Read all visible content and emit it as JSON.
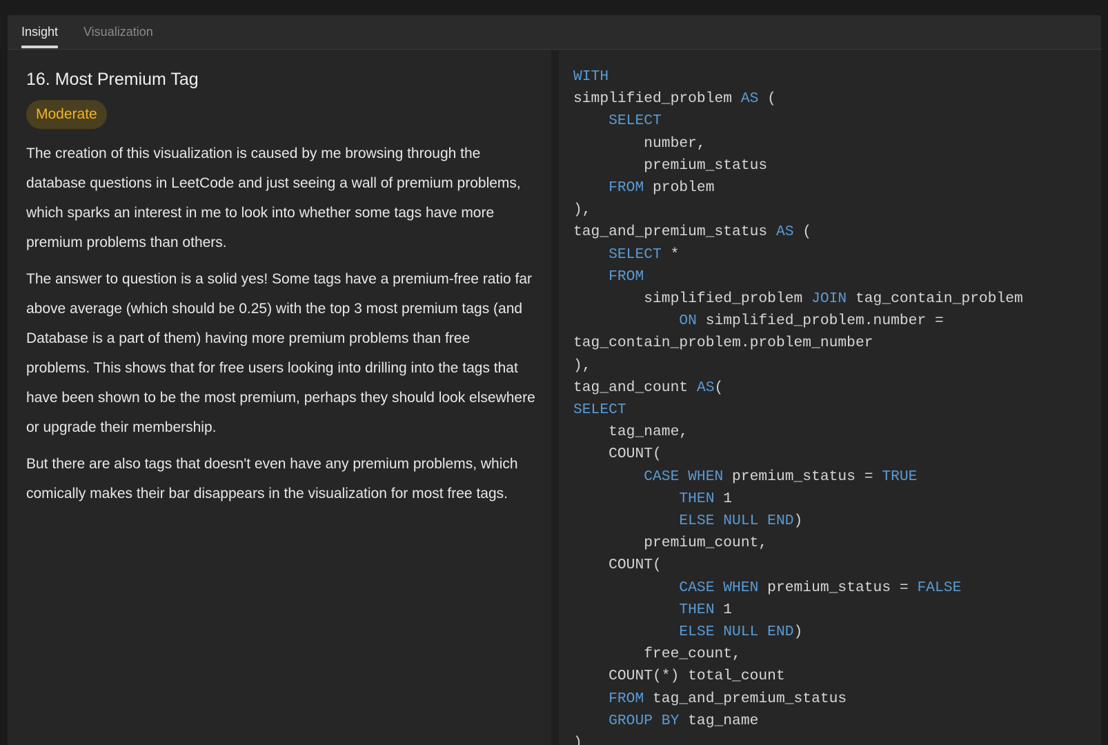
{
  "tabs": [
    {
      "label": "Insight",
      "active": true
    },
    {
      "label": "Visualization",
      "active": false
    }
  ],
  "insight": {
    "title": "16. Most Premium Tag",
    "difficulty": "Moderate",
    "paragraphs": [
      "The creation of this visualization is caused by me browsing through the database questions in LeetCode and just seeing a wall of premium problems, which sparks an interest in me to look into whether some tags have more premium problems than others.",
      "The answer to question is a solid yes! Some tags have a premium-free ratio far above average (which should be 0.25) with the top 3 most premium tags (and Database is a part of them) having more premium problems than free problems. This shows that for free users looking into drilling into the tags that have been shown to be the most premium, perhaps they should look elsewhere or upgrade their membership.",
      "But there are also tags that doesn't even have any premium problems, which comically makes their bar disappears in the visualization for most free tags."
    ]
  },
  "code": {
    "lines": [
      [
        [
          "k",
          "WITH"
        ]
      ],
      [
        [
          "t",
          "simplified_problem "
        ],
        [
          "k",
          "AS"
        ],
        [
          "t",
          " ("
        ]
      ],
      [
        [
          "t",
          "    "
        ],
        [
          "k",
          "SELECT"
        ]
      ],
      [
        [
          "t",
          "        number,"
        ]
      ],
      [
        [
          "t",
          "        premium_status"
        ]
      ],
      [
        [
          "t",
          "    "
        ],
        [
          "k",
          "FROM"
        ],
        [
          "t",
          " problem"
        ]
      ],
      [
        [
          "t",
          "),"
        ]
      ],
      [
        [
          "t",
          "tag_and_premium_status "
        ],
        [
          "k",
          "AS"
        ],
        [
          "t",
          " ("
        ]
      ],
      [
        [
          "t",
          "    "
        ],
        [
          "k",
          "SELECT"
        ],
        [
          "t",
          " *"
        ]
      ],
      [
        [
          "t",
          "    "
        ],
        [
          "k",
          "FROM"
        ]
      ],
      [
        [
          "t",
          "        simplified_problem "
        ],
        [
          "k",
          "JOIN"
        ],
        [
          "t",
          " tag_contain_problem"
        ]
      ],
      [
        [
          "t",
          "            "
        ],
        [
          "k",
          "ON"
        ],
        [
          "t",
          " simplified_problem.number ="
        ]
      ],
      [
        [
          "t",
          "tag_contain_problem.problem_number"
        ]
      ],
      [
        [
          "t",
          "),"
        ]
      ],
      [
        [
          "t",
          "tag_and_count "
        ],
        [
          "k",
          "AS"
        ],
        [
          "t",
          "("
        ]
      ],
      [
        [
          "k",
          "SELECT"
        ]
      ],
      [
        [
          "t",
          "    tag_name,"
        ]
      ],
      [
        [
          "t",
          "    COUNT("
        ]
      ],
      [
        [
          "t",
          "        "
        ],
        [
          "k",
          "CASE WHEN"
        ],
        [
          "t",
          " premium_status = "
        ],
        [
          "k",
          "TRUE"
        ]
      ],
      [
        [
          "t",
          "            "
        ],
        [
          "k",
          "THEN"
        ],
        [
          "t",
          " 1"
        ]
      ],
      [
        [
          "t",
          "            "
        ],
        [
          "k",
          "ELSE NULL END"
        ],
        [
          "t",
          ")"
        ]
      ],
      [
        [
          "t",
          "        premium_count,"
        ]
      ],
      [
        [
          "t",
          "    COUNT("
        ]
      ],
      [
        [
          "t",
          "            "
        ],
        [
          "k",
          "CASE WHEN"
        ],
        [
          "t",
          " premium_status = "
        ],
        [
          "k",
          "FALSE"
        ]
      ],
      [
        [
          "t",
          "            "
        ],
        [
          "k",
          "THEN"
        ],
        [
          "t",
          " 1"
        ]
      ],
      [
        [
          "t",
          "            "
        ],
        [
          "k",
          "ELSE NULL END"
        ],
        [
          "t",
          ")"
        ]
      ],
      [
        [
          "t",
          "        free_count,"
        ]
      ],
      [
        [
          "t",
          "    COUNT(*) total_count"
        ]
      ],
      [
        [
          "t",
          "    "
        ],
        [
          "k",
          "FROM"
        ],
        [
          "t",
          " tag_and_premium_status"
        ]
      ],
      [
        [
          "t",
          "    "
        ],
        [
          "k",
          "GROUP BY"
        ],
        [
          "t",
          " tag_name"
        ]
      ],
      [
        [
          "t",
          ")"
        ]
      ]
    ],
    "colors": {
      "keyword": "#5a9bd5",
      "text": "#d6d6d6"
    }
  },
  "colors": {
    "background": "#1b1b1b",
    "panel": "#262626",
    "badge_bg": "#4a3f1f",
    "badge_text": "#f0b429"
  }
}
